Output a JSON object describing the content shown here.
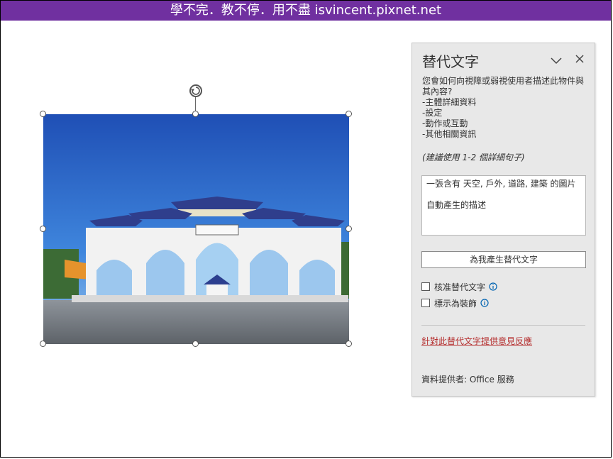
{
  "banner": {
    "text": "學不完．教不停．用不盡 isvincent.pixnet.net"
  },
  "image": {
    "description": "Photo of a white memorial archway with blue roofs under a blue sky"
  },
  "pane": {
    "title": "替代文字",
    "question_line1": "您會如何向視障或弱視使用者描述此物件與",
    "question_line2": "其內容?",
    "bullets": [
      "-主體詳細資料",
      "-設定",
      "-動作或互動",
      "-其他相關資訊"
    ],
    "hint": "(建議使用 1-2 個詳細句子)",
    "alt_text": {
      "line1": "一張含有 天空, 戶外, 道路, 建築 的圖片",
      "line2": "自動產生的描述"
    },
    "generate_button": "為我產生替代文字",
    "approve_label": "核准替代文字",
    "decorative_label": "標示為裝飾",
    "feedback_link": "針對此替代文字提供意見反應",
    "provider": "資料提供者: Office 服務",
    "accent_color": "#b52e2e",
    "info_color": "#0063b1"
  }
}
